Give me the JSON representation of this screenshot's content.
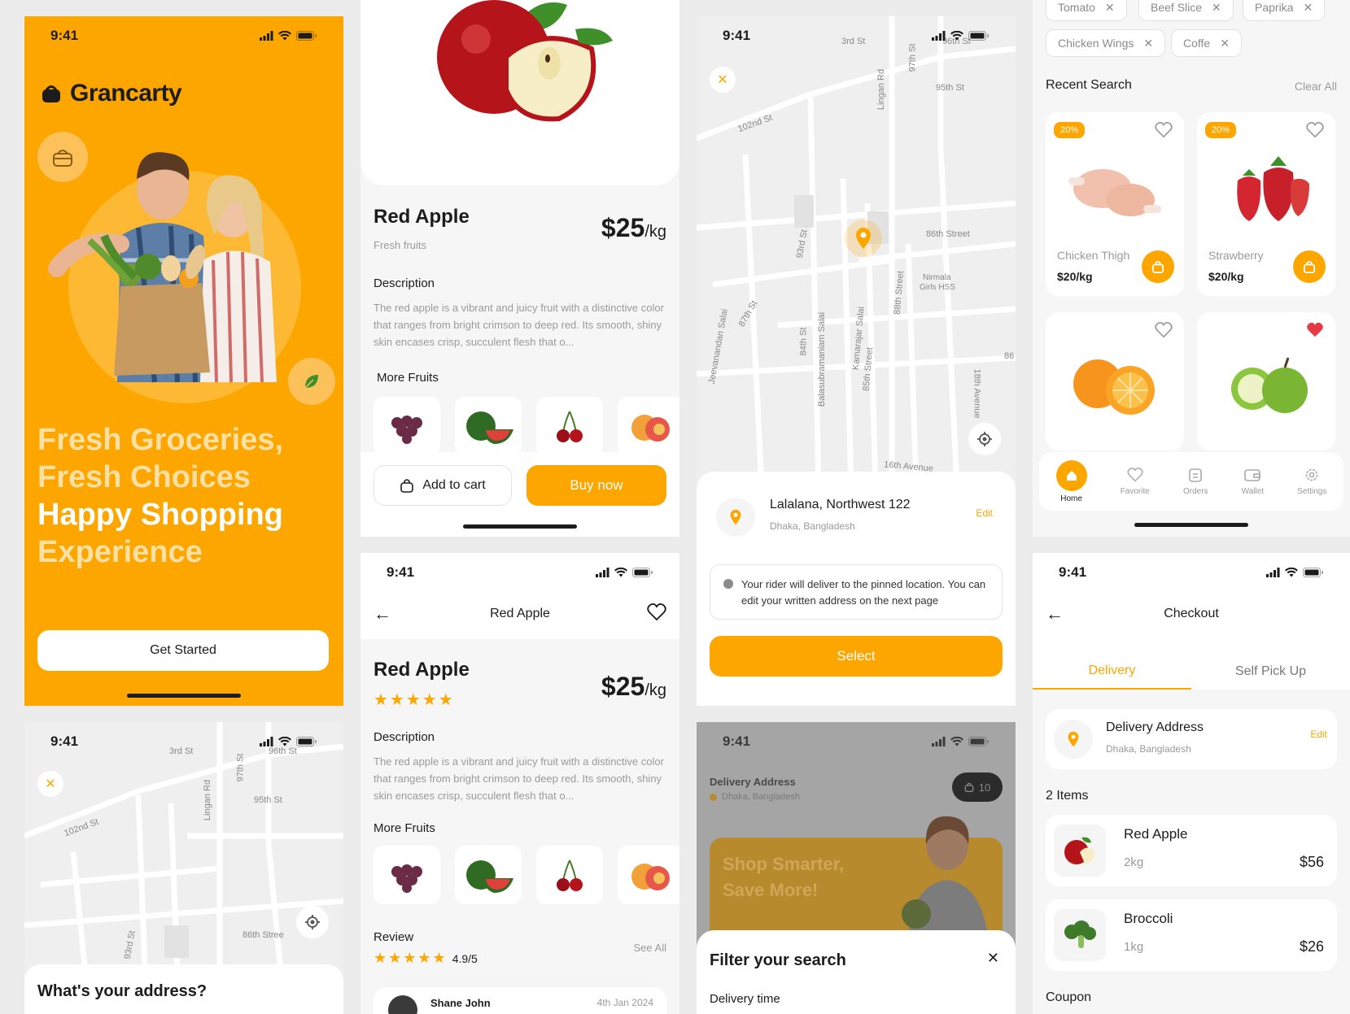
{
  "colors": {
    "brand": "#fda600",
    "text": "#1c1c1c",
    "muted": "#9a9a9a",
    "bg": "#f6f6f6"
  },
  "status": {
    "time": "9:41"
  },
  "welcome": {
    "brand": "Grancarty",
    "headline_1": "Fresh Groceries,",
    "headline_2": "Fresh Choices",
    "headline_3": "Happy Shopping",
    "headline_4": "Experience",
    "cta": "Get Started"
  },
  "product_top": {
    "name": "Red Apple",
    "category": "Fresh fruits",
    "price": "$25",
    "unit": "/kg",
    "description_title": "Description",
    "description": "The red apple is a vibrant and juicy fruit with a distinctive color that ranges from bright crimson to deep red. Its smooth, shiny skin encases crisp, succulent flesh that o...",
    "more_title": "More Fruits",
    "add_to_cart": "Add to cart",
    "buy_now": "Buy now"
  },
  "product_detail": {
    "header_title": "Red Apple",
    "name": "Red Apple",
    "price": "$25",
    "unit": "/kg",
    "description_title": "Description",
    "description": "The red apple is a vibrant and juicy fruit with a distinctive color that ranges from bright crimson to deep red. Its smooth, shiny skin encases crisp, succulent flesh that o...",
    "more_title": "More Fruits",
    "review_title": "Review",
    "review_score": "4.9/5",
    "see_all": "See All",
    "reviewer": "Shane John",
    "review_date": "4th Jan 2024"
  },
  "map_streets": {
    "s1": "3rd St",
    "s2": "96th St",
    "s3": "97th St",
    "s4": "Lingan Rd",
    "s5": "95th St",
    "s6": "102nd St",
    "s7": "86th Street",
    "s8": "Nirmala",
    "s9": "Girls HSS",
    "s10": "93rd St",
    "s11": "87th St",
    "s12": "Jeevanandan Salai",
    "s13": "84th St",
    "s14": "Balasubramaniam Salai",
    "s15": "Kamarajar Salai",
    "s16": "85th Street",
    "s17": "88th Street",
    "s18": "18th Avenue",
    "s19": "16th Avenue",
    "s20": "86",
    "s21": "86th Stree",
    "s22": "93rd St"
  },
  "location": {
    "title": "Lalalana, Northwest 122",
    "subtitle": "Dhaka, Bangladesh",
    "edit": "Edit",
    "notice": "Your rider will deliver to the pinned location. You can edit your written address on the next page",
    "select": "Select"
  },
  "address_prompt": {
    "title": "What's your address?"
  },
  "filter": {
    "title": "Filter your search",
    "delivery_time": "Delivery time",
    "bg_address_title": "Delivery Address",
    "bg_address_sub": "Dhaka, Bangladesh",
    "bg_cart_count": "10",
    "bg_banner_1": "Shop Smarter,",
    "bg_banner_2": "Save More!"
  },
  "search": {
    "chips": [
      "Tomato",
      "Beef Slice",
      "Paprika",
      "Chicken Wings",
      "Coffe"
    ],
    "recent_title": "Recent Search",
    "clear_all": "Clear All",
    "discount": "20%",
    "items": [
      {
        "name": "Chicken Thigh",
        "price": "$20/kg"
      },
      {
        "name": "Strawberry",
        "price": "$20/kg"
      }
    ],
    "nav": [
      "Home",
      "Favorite",
      "Orders",
      "Wallet",
      "Settings"
    ]
  },
  "checkout": {
    "title": "Checkout",
    "tab_delivery": "Delivery",
    "tab_pickup": "Self Pick Up",
    "address_title": "Delivery Address",
    "address_sub": "Dhaka, Bangladesh",
    "edit": "Edit",
    "items_count": "2 Items",
    "items": [
      {
        "name": "Red Apple",
        "qty": "2kg",
        "price": "$56"
      },
      {
        "name": "Broccoli",
        "qty": "1kg",
        "price": "$26"
      }
    ],
    "coupon": "Coupon"
  }
}
